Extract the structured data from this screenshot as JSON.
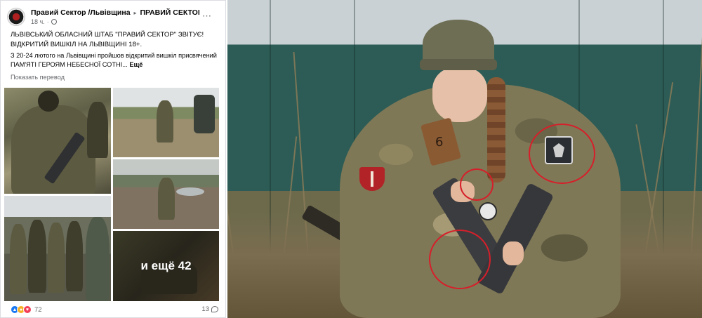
{
  "post": {
    "author": "Правий Сектор /Львівщина",
    "separator": "▸",
    "group": "ПРАВИЙ СЕКТОР",
    "time": "18 ч.",
    "time_dot": "·",
    "more_icon": "⋯",
    "headline_1": "ЛЬВІВСЬКИЙ ОБЛАСНИЙ ШТАБ \"ПРАВИЙ СЕКТОР\" ЗВІТУЄ!",
    "headline_2": "ВІДКРИТИЙ ВИШКІЛ НА ЛЬВІВЩИНІ 18+.",
    "body": "З 20-24 лютого на Львівщині пройшов відкритий вишкіл присвячений  ПАМ'ЯТІ ГЕРОЯМ НЕБЕСНОЇ СОТНІ...",
    "more_link": "Ещё",
    "translate": "Показать перевод",
    "gallery_more": "и ещё 42",
    "reactions_count": "72",
    "comments_count": "13"
  },
  "photo": {
    "strap_number": "6"
  },
  "colors": {
    "highlight_circle": "#d61f2a",
    "link_gray": "#65676b",
    "like_blue": "#1877f2"
  }
}
